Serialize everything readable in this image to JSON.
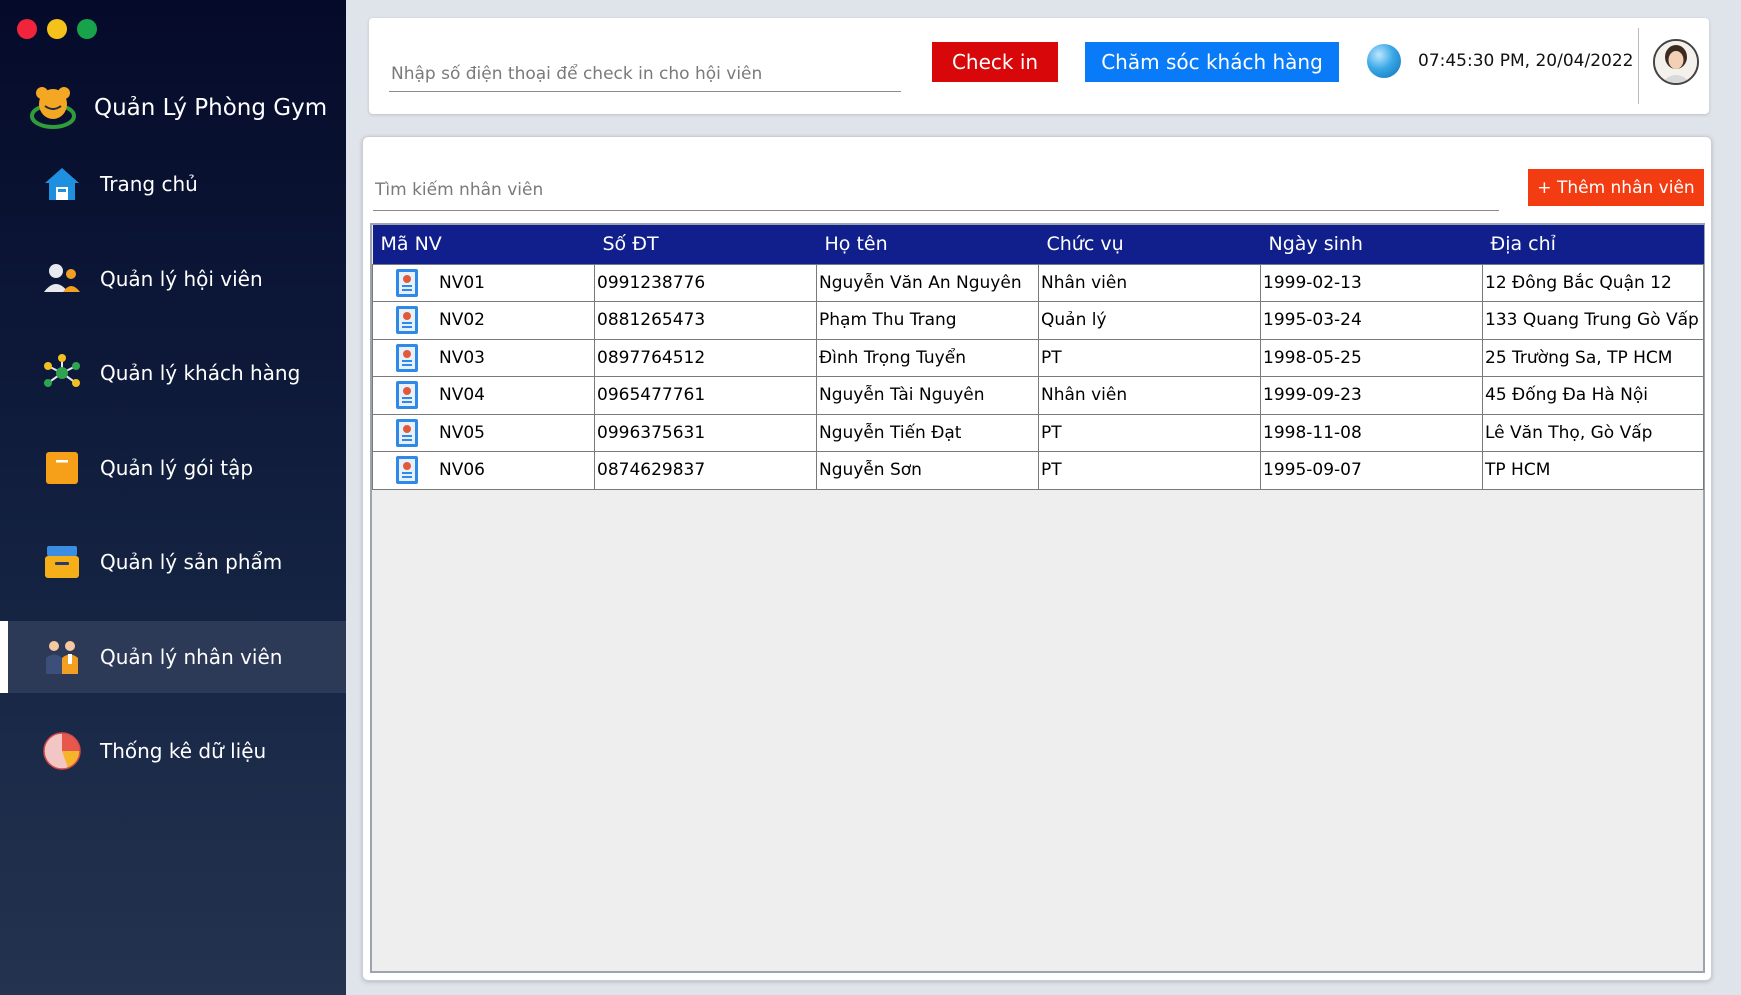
{
  "sidebar": {
    "brand": "Quản Lý Phòng Gym",
    "items": [
      {
        "label": "Trang chủ",
        "icon": "home-icon"
      },
      {
        "label": "Quản lý hội viên",
        "icon": "members-icon"
      },
      {
        "label": "Quản lý khách hàng",
        "icon": "network-icon"
      },
      {
        "label": "Quản lý gói tập",
        "icon": "package-icon"
      },
      {
        "label": "Quản lý sản phẩm",
        "icon": "product-box-icon"
      },
      {
        "label": "Quản lý nhân viên",
        "icon": "staff-icon",
        "active": true
      },
      {
        "label": "Thống kê dữ liệu",
        "icon": "pie-chart-icon"
      }
    ]
  },
  "topbar": {
    "checkin_placeholder": "Nhập số điện thoại để check in cho hội viên",
    "checkin_label": "Check in",
    "care_label": "Chăm sóc khách hàng",
    "datetime": "07:45:30 PM, 20/04/2022"
  },
  "main": {
    "search_placeholder": "Tìm kiếm nhân viên",
    "add_label": "+ Thêm nhân viên",
    "columns": [
      "Mã NV",
      "Số ĐT",
      "Họ tên",
      "Chức vụ",
      "Ngày sinh",
      "Địa chỉ"
    ],
    "rows": [
      [
        "NV01",
        "0991238776",
        "Nguyễn Văn An Nguyên",
        "Nhân viên",
        "1999-02-13",
        "12 Đông Bắc Quận 12"
      ],
      [
        "NV02",
        "0881265473",
        "Phạm Thu Trang",
        "Quản lý",
        "1995-03-24",
        "133 Quang Trung Gò Vấp"
      ],
      [
        "NV03",
        "0897764512",
        "Đình Trọng Tuyển",
        "PT",
        "1998-05-25",
        "25 Trường Sa, TP HCM"
      ],
      [
        "NV04",
        "0965477761",
        "Nguyễn Tài Nguyên",
        "Nhân viên",
        "1999-09-23",
        "45 Đống Đa Hà Nội"
      ],
      [
        "NV05",
        "0996375631",
        "Nguyễn Tiến Đạt",
        "PT",
        "1998-11-08",
        "Lê Văn Thọ, Gò Vấp"
      ],
      [
        "NV06",
        "0874629837",
        "Nguyễn Sơn",
        "PT",
        "1995-09-07",
        "TP HCM"
      ]
    ]
  },
  "colors": {
    "header": "#101f8c",
    "checkin": "#d8070a",
    "care": "#0a7bf8",
    "add": "#f43c12"
  }
}
